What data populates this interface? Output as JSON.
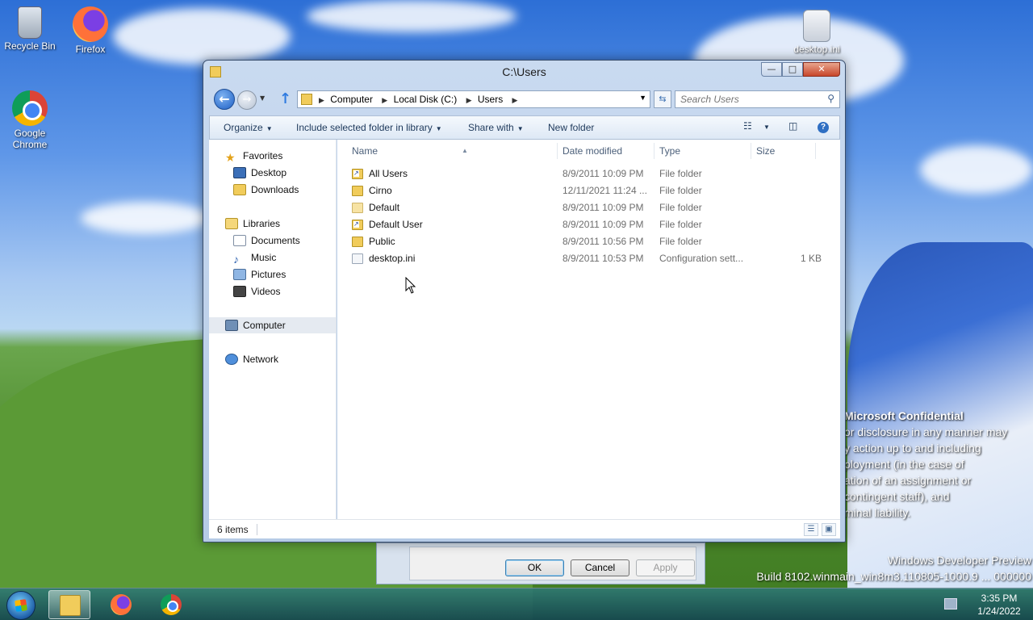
{
  "desktop": {
    "icons": [
      {
        "label": "Recycle Bin"
      },
      {
        "label": "Firefox"
      },
      {
        "label": "Google\nChrome"
      },
      {
        "label": "desktop.ini"
      }
    ],
    "confidential": {
      "title": "Microsoft Confidential",
      "lines": [
        "or disclosure in any manner may",
        "y action up to and including",
        "ployment (in the case of",
        "ation of an assignment or",
        "contingent staff), and",
        "minal liability."
      ]
    },
    "watermark": {
      "line1": "Windows Developer Preview",
      "line2": "Build 8102.winmain_win8m3.110805-1000.9 ... 000000"
    }
  },
  "back_dialog": {
    "ok": "OK",
    "cancel": "Cancel",
    "apply": "Apply"
  },
  "window": {
    "title": "C:\\Users",
    "controls": {
      "minimize": "—",
      "maximize": "□",
      "close": "✕"
    },
    "address": {
      "crumbs": [
        "Computer",
        "Local Disk (C:)",
        "Users"
      ]
    },
    "search": {
      "placeholder": "Search Users"
    },
    "toolbar": {
      "organize": "Organize",
      "include": "Include selected folder in library",
      "share": "Share with",
      "new_folder": "New folder"
    },
    "nav": {
      "favorites": "Favorites",
      "desktop": "Desktop",
      "downloads": "Downloads",
      "libraries": "Libraries",
      "documents": "Documents",
      "music": "Music",
      "pictures": "Pictures",
      "videos": "Videos",
      "computer": "Computer",
      "network": "Network"
    },
    "columns": {
      "name": "Name",
      "date": "Date modified",
      "type": "Type",
      "size": "Size"
    },
    "files": [
      {
        "name": "All Users",
        "date": "8/9/2011 10:09 PM",
        "type": "File folder",
        "size": ""
      },
      {
        "name": "Cirno",
        "date": "12/11/2021 11:24 ...",
        "type": "File folder",
        "size": ""
      },
      {
        "name": "Default",
        "date": "8/9/2011 10:09 PM",
        "type": "File folder",
        "size": ""
      },
      {
        "name": "Default User",
        "date": "8/9/2011 10:09 PM",
        "type": "File folder",
        "size": ""
      },
      {
        "name": "Public",
        "date": "8/9/2011 10:56 PM",
        "type": "File folder",
        "size": ""
      },
      {
        "name": "desktop.ini",
        "date": "8/9/2011 10:53 PM",
        "type": "Configuration sett...",
        "size": "1 KB"
      }
    ],
    "status": {
      "count": "6 items"
    }
  },
  "taskbar": {
    "time": "3:35 PM",
    "date": "1/24/2022"
  }
}
